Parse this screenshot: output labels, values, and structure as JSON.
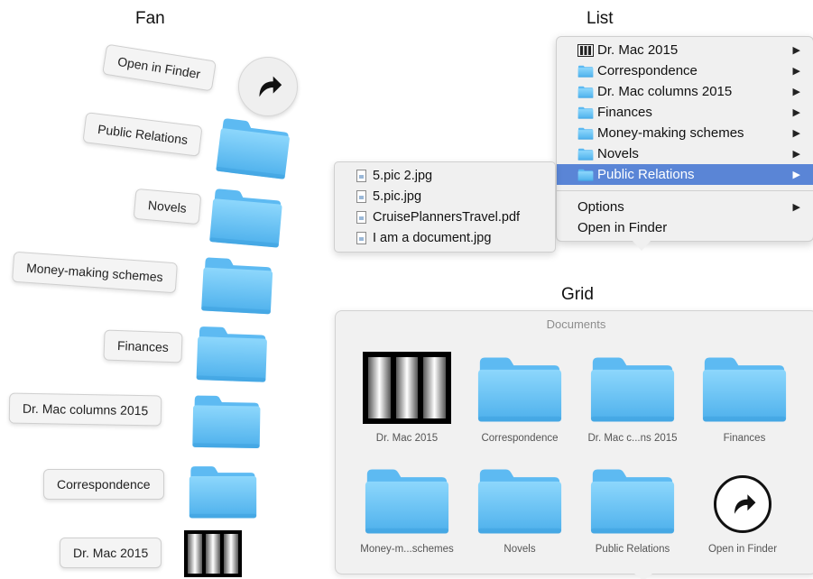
{
  "fan": {
    "title": "Fan",
    "open_in_finder": "Open in Finder",
    "items": [
      {
        "label": "Public Relations",
        "icon": "folder-icon"
      },
      {
        "label": "Novels",
        "icon": "folder-icon"
      },
      {
        "label": "Money-making schemes",
        "icon": "folder-icon"
      },
      {
        "label": "Finances",
        "icon": "folder-icon"
      },
      {
        "label": "Dr. Mac columns 2015",
        "icon": "folder-icon"
      },
      {
        "label": "Correspondence",
        "icon": "folder-icon"
      },
      {
        "label": "Dr. Mac 2015",
        "icon": "stack-icon"
      }
    ]
  },
  "list": {
    "title": "List",
    "items": [
      {
        "label": "Dr. Mac 2015",
        "icon": "stack-icon"
      },
      {
        "label": "Correspondence",
        "icon": "folder-icon"
      },
      {
        "label": "Dr. Mac columns 2015",
        "icon": "folder-icon"
      },
      {
        "label": "Finances",
        "icon": "folder-icon"
      },
      {
        "label": "Money-making schemes",
        "icon": "folder-icon"
      },
      {
        "label": "Novels",
        "icon": "folder-icon"
      },
      {
        "label": "Public Relations",
        "icon": "folder-icon",
        "selected": true
      }
    ],
    "options": "Options",
    "open_in_finder": "Open in Finder",
    "submenu": [
      "5.pic 2.jpg",
      "5.pic.jpg",
      "CruisePlannersTravel.pdf",
      "I am a document.jpg"
    ],
    "selection_color": "#5a85d6"
  },
  "grid": {
    "title": "Grid",
    "header": "Documents",
    "items": [
      {
        "label": "Dr. Mac 2015",
        "icon": "stack-icon"
      },
      {
        "label": "Correspondence",
        "icon": "folder-icon"
      },
      {
        "label": "Dr. Mac c...ns 2015",
        "icon": "folder-icon"
      },
      {
        "label": "Finances",
        "icon": "folder-icon"
      },
      {
        "label": "Money-m...schemes",
        "icon": "folder-icon"
      },
      {
        "label": "Novels",
        "icon": "folder-icon"
      },
      {
        "label": "Public Relations",
        "icon": "folder-icon"
      },
      {
        "label": "Open in Finder",
        "icon": "open-arrow-icon"
      }
    ]
  },
  "colors": {
    "folder_light": "#7fd0fb",
    "folder_dark": "#4fb1ec",
    "folder_tab": "#62bdf3"
  }
}
